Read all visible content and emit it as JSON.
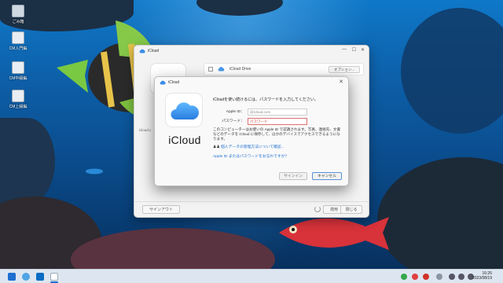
{
  "desktop": {
    "icons": [
      {
        "label": "ごみ箱",
        "icon": "recycle-bin-icon"
      },
      {
        "label": "CM入門編",
        "icon": "shortcut-icon"
      },
      {
        "label": "CM中級編",
        "icon": "shortcut-icon"
      },
      {
        "label": "CM上級編",
        "icon": "shortcut-icon"
      }
    ]
  },
  "main_window": {
    "title": "iCloud",
    "drive_label": "iCloud Drive",
    "options_button": "オプション...",
    "account_fragment": "icloud.c",
    "signout_button": "サインアウト",
    "apply_button": "適用",
    "close_button": "閉じる"
  },
  "dialog": {
    "title": "iCloud",
    "brand": "iCloud",
    "prompt": "iCloudを使い続けるには、パスワードを入力してください。",
    "apple_id_label": "Apple ID：",
    "apple_id_value": "@icloud.com",
    "password_label": "パスワード：",
    "password_placeholder": "パスワード",
    "info_text": "このコンピューターはお使いの Apple ID で認識されます。写真、連絡先、文書などのデータを iCloud に保存して、ほかのデバイスでアクセスできるようになります。",
    "privacy_link": "個人データの管理方法について確認...",
    "forgot_link": "Apple ID またはパスワードをお忘れですか？",
    "signin_button": "サインイン",
    "cancel_button": "キャンセル"
  },
  "taskbar": {
    "time": "16:26",
    "date": "2023/08/19"
  },
  "colors": {
    "accent": "#1f6fd1",
    "taskbar": "#dde6f0"
  }
}
